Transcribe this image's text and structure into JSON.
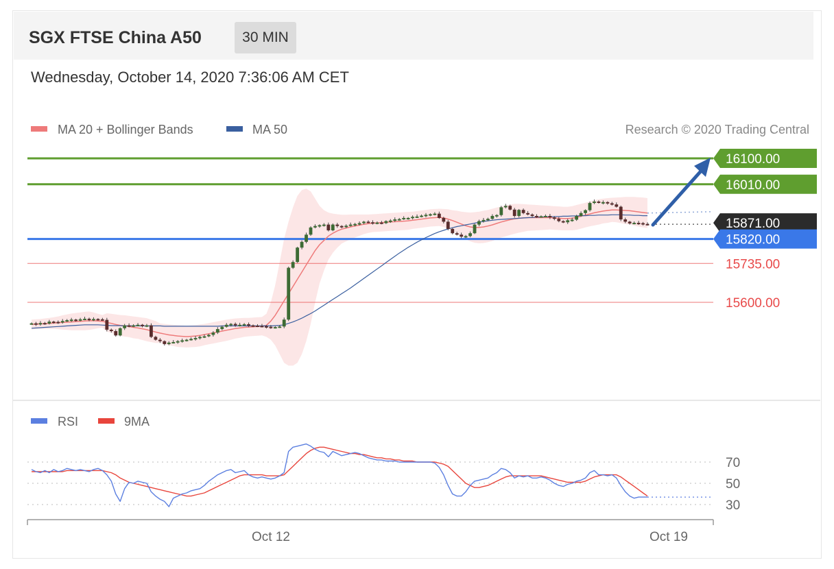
{
  "header": {
    "title": "SGX FTSE China A50",
    "timeframe": "30 MIN",
    "date": "Wednesday, October 14, 2020 7:36:06 AM CET"
  },
  "colors": {
    "ma20": "#ee7a7a",
    "band": "#fbe2e2",
    "ma50": "#3a5f9f",
    "resistance": "#5f9e2f",
    "support_blue": "#3a78e8",
    "support_red": "#e84a4a",
    "last": "#2b2b2b",
    "rsi": "#5b7fe0",
    "rsi_ma": "#e8453c",
    "arrow": "#2f5fa8"
  },
  "chart_data": [
    {
      "type": "candlestick",
      "legend": [
        {
          "name": "MA 20 + Bollinger Bands",
          "color": "#ee7a7a"
        },
        {
          "name": "MA 50",
          "color": "#3a5f9f"
        }
      ],
      "copyright": "Research © 2020 Trading Central",
      "ylim": [
        15490,
        16140
      ],
      "levels": [
        {
          "value": 16100,
          "label": "16100.00",
          "kind": "resistance"
        },
        {
          "value": 16010,
          "label": "16010.00",
          "kind": "resistance"
        },
        {
          "value": 15871,
          "label": "15871.00",
          "kind": "last"
        },
        {
          "value": 15820,
          "label": "15820.00",
          "kind": "pivot"
        },
        {
          "value": 15735,
          "label": "15735.00",
          "kind": "support"
        },
        {
          "value": 15600,
          "label": "15600.00",
          "kind": "support"
        }
      ],
      "close": [
        15527,
        15524,
        15528,
        15526,
        15533,
        15532,
        15530,
        15535,
        15538,
        15540,
        15538,
        15541,
        15543,
        15540,
        15542,
        15541,
        15539,
        15505,
        15500,
        15485,
        15510,
        15520,
        15518,
        15520,
        15522,
        15519,
        15520,
        15480,
        15470,
        15465,
        15455,
        15460,
        15462,
        15465,
        15468,
        15470,
        15473,
        15476,
        15480,
        15482,
        15487,
        15495,
        15507,
        15515,
        15522,
        15525,
        15520,
        15522,
        15524,
        15520,
        15519,
        15518,
        15517,
        15515,
        15513,
        15514,
        15516,
        15540,
        15720,
        15740,
        15790,
        15810,
        15835,
        15860,
        15865,
        15868,
        15870,
        15850,
        15870,
        15865,
        15862,
        15866,
        15870,
        15872,
        15875,
        15880,
        15878,
        15876,
        15877,
        15875,
        15882,
        15884,
        15888,
        15889,
        15893,
        15893,
        15897,
        15898,
        15901,
        15904,
        15906,
        15908,
        15893,
        15880,
        15855,
        15840,
        15835,
        15828,
        15830,
        15840,
        15870,
        15882,
        15886,
        15890,
        15900,
        15903,
        15930,
        15935,
        15922,
        15900,
        15921,
        15910,
        15905,
        15900,
        15898,
        15899,
        15900,
        15895,
        15890,
        15882,
        15878,
        15885,
        15887,
        15900,
        15910,
        15920,
        15945,
        15950,
        15946,
        15948,
        15944,
        15940,
        15932,
        15888,
        15880,
        15874,
        15876,
        15875,
        15872,
        15871
      ],
      "ma20": [
        15523,
        15524,
        15525,
        15526,
        15527,
        15528,
        15529,
        15530,
        15531,
        15532,
        15533,
        15534,
        15535,
        15536,
        15536,
        15535,
        15534,
        15530,
        15527,
        15523,
        15520,
        15518,
        15516,
        15513,
        15511,
        15508,
        15505,
        15501,
        15497,
        15493,
        15490,
        15487,
        15485,
        15483,
        15482,
        15481,
        15482,
        15483,
        15485,
        15488,
        15491,
        15494,
        15497,
        15500,
        15503,
        15506,
        15509,
        15511,
        15513,
        15514,
        15515,
        15516,
        15517,
        15520,
        15535,
        15555,
        15580,
        15605,
        15630,
        15655,
        15680,
        15705,
        15730,
        15755,
        15780,
        15800,
        15815,
        15830,
        15840,
        15848,
        15854,
        15858,
        15862,
        15865,
        15868,
        15871,
        15873,
        15875,
        15876,
        15877,
        15878,
        15879,
        15880,
        15881,
        15882,
        15883,
        15885,
        15887,
        15889,
        15891,
        15893,
        15894,
        15895,
        15893,
        15889,
        15884,
        15878,
        15872,
        15866,
        15862,
        15860,
        15860,
        15862,
        15865,
        15869,
        15874,
        15879,
        15883,
        15887,
        15890,
        15892,
        15893,
        15894,
        15894,
        15894,
        15894,
        15894,
        15894,
        15893,
        15892,
        15891,
        15891,
        15892,
        15895,
        15899,
        15903,
        15907,
        15911,
        15914,
        15917,
        15919,
        15921,
        15921,
        15920,
        15919,
        15918,
        15916,
        15914,
        15912,
        15910
      ],
      "upper": [
        15540,
        15541,
        15542,
        15544,
        15546,
        15548,
        15551,
        15555,
        15558,
        15561,
        15563,
        15565,
        15567,
        15568,
        15565,
        15560,
        15556,
        15562,
        15560,
        15558,
        15556,
        15555,
        15553,
        15551,
        15549,
        15547,
        15545,
        15540,
        15535,
        15527,
        15525,
        15523,
        15522,
        15521,
        15520,
        15519,
        15520,
        15521,
        15523,
        15525,
        15528,
        15531,
        15534,
        15537,
        15540,
        15542,
        15544,
        15545,
        15546,
        15546,
        15547,
        15548,
        15549,
        15560,
        15600,
        15660,
        15740,
        15820,
        15880,
        15930,
        15970,
        15990,
        15995,
        15985,
        15960,
        15935,
        15920,
        15912,
        15908,
        15906,
        15904,
        15904,
        15905,
        15905,
        15905,
        15905,
        15905,
        15906,
        15907,
        15908,
        15909,
        15910,
        15911,
        15912,
        15913,
        15914,
        15915,
        15917,
        15919,
        15921,
        15923,
        15924,
        15925,
        15924,
        15923,
        15920,
        15918,
        15915,
        15913,
        15912,
        15913,
        15915,
        15918,
        15921,
        15925,
        15929,
        15933,
        15937,
        15940,
        15942,
        15942,
        15941,
        15940,
        15939,
        15938,
        15937,
        15936,
        15935,
        15934,
        15933,
        15932,
        15932,
        15934,
        15938,
        15942,
        15946,
        15950,
        15955,
        15958,
        15960,
        15962,
        15963,
        15964,
        15965,
        15966,
        15966,
        15966,
        15965,
        15964,
        15962
      ],
      "lower": [
        15506,
        15507,
        15508,
        15508,
        15508,
        15508,
        15507,
        15505,
        15504,
        15503,
        15503,
        15503,
        15503,
        15504,
        15507,
        15510,
        15512,
        15498,
        15494,
        15488,
        15484,
        15481,
        15479,
        15475,
        15473,
        15469,
        15465,
        15462,
        15459,
        15459,
        15455,
        15451,
        15448,
        15445,
        15444,
        15443,
        15444,
        15445,
        15447,
        15451,
        15454,
        15457,
        15460,
        15463,
        15466,
        15470,
        15474,
        15477,
        15480,
        15482,
        15483,
        15484,
        15485,
        15480,
        15470,
        15450,
        15420,
        15390,
        15380,
        15380,
        15390,
        15420,
        15465,
        15525,
        15600,
        15665,
        15710,
        15748,
        15772,
        15790,
        15804,
        15812,
        15819,
        15825,
        15831,
        15837,
        15841,
        15844,
        15845,
        15846,
        15847,
        15848,
        15849,
        15850,
        15851,
        15852,
        15855,
        15857,
        15859,
        15861,
        15863,
        15864,
        15865,
        15862,
        15855,
        15848,
        15838,
        15829,
        15819,
        15812,
        15807,
        15805,
        15806,
        15809,
        15813,
        15819,
        15825,
        15829,
        15834,
        15838,
        15842,
        15845,
        15848,
        15849,
        15850,
        15851,
        15852,
        15853,
        15852,
        15851,
        15850,
        15850,
        15850,
        15852,
        15856,
        15860,
        15864,
        15867,
        15870,
        15874,
        15876,
        15879,
        15878,
        15875,
        15872,
        15870,
        15866,
        15863,
        15860,
        15858
      ],
      "ma50": [
        15510,
        15511,
        15512,
        15513,
        15514,
        15515,
        15516,
        15517,
        15518,
        15519,
        15520,
        15521,
        15522,
        15522,
        15522,
        15522,
        15521,
        15520,
        15519,
        15519,
        15519,
        15518,
        15518,
        15518,
        15518,
        15518,
        15518,
        15518,
        15518,
        15518,
        15517,
        15517,
        15517,
        15517,
        15517,
        15517,
        15517,
        15517,
        15517,
        15517,
        15517,
        15517,
        15517,
        15518,
        15518,
        15518,
        15518,
        15518,
        15518,
        15518,
        15518,
        15518,
        15518,
        15518,
        15518,
        15519,
        15520,
        15522,
        15527,
        15532,
        15538,
        15545,
        15553,
        15561,
        15570,
        15580,
        15590,
        15600,
        15610,
        15620,
        15630,
        15640,
        15650,
        15661,
        15672,
        15683,
        15694,
        15705,
        15716,
        15727,
        15738,
        15749,
        15760,
        15771,
        15781,
        15791,
        15800,
        15809,
        15817,
        15825,
        15832,
        15839,
        15845,
        15850,
        15855,
        15859,
        15863,
        15866,
        15869,
        15872,
        15875,
        15878,
        15881,
        15883,
        15885,
        15887,
        15888,
        15889,
        15890,
        15891,
        15892,
        15893,
        15894,
        15895,
        15896,
        15896,
        15897,
        15897,
        15898,
        15898,
        15899,
        15899,
        15900,
        15900,
        15901,
        15901,
        15902,
        15902,
        15903,
        15903,
        15903,
        15904,
        15904,
        15904,
        15903,
        15903,
        15902,
        15902,
        15901,
        15901
      ]
    },
    {
      "type": "line",
      "legend": [
        {
          "name": "RSI",
          "color": "#5b7fe0"
        },
        {
          "name": "9MA",
          "color": "#e8453c"
        }
      ],
      "ylim": [
        25,
        90
      ],
      "yticks": [
        70,
        50,
        30
      ],
      "xticks": [
        "Oct 12",
        "Oct 19"
      ],
      "rsi": [
        63,
        61,
        60,
        62,
        60,
        63,
        61,
        62,
        64,
        63,
        62,
        63,
        62,
        61,
        63,
        64,
        62,
        58,
        52,
        40,
        33,
        45,
        51,
        50,
        52,
        51,
        50,
        42,
        38,
        35,
        33,
        28,
        36,
        38,
        40,
        41,
        43,
        44,
        45,
        48,
        52,
        55,
        58,
        60,
        62,
        63,
        60,
        61,
        62,
        58,
        56,
        55,
        56,
        55,
        54,
        55,
        57,
        60,
        80,
        84,
        85,
        86,
        87,
        85,
        82,
        80,
        79,
        75,
        80,
        78,
        76,
        77,
        78,
        79,
        78,
        76,
        74,
        73,
        72,
        72,
        71,
        71,
        71,
        70,
        70,
        70,
        70,
        70,
        70,
        70,
        70,
        69,
        65,
        58,
        48,
        40,
        38,
        38,
        42,
        48,
        52,
        53,
        54,
        55,
        58,
        60,
        64,
        63,
        60,
        55,
        57,
        56,
        57,
        55,
        55,
        56,
        55,
        53,
        50,
        48,
        47,
        49,
        50,
        52,
        53,
        55,
        60,
        62,
        58,
        58,
        57,
        58,
        55,
        48,
        42,
        38,
        36,
        37,
        37,
        37
      ],
      "ma": [
        61,
        61,
        61,
        61,
        61,
        61,
        61,
        61,
        62,
        62,
        62,
        62,
        62,
        62,
        62,
        62,
        62,
        61,
        60,
        58,
        55,
        53,
        51,
        50,
        49,
        48,
        47,
        46,
        45,
        44,
        43,
        42,
        41,
        40,
        39,
        38,
        38,
        39,
        40,
        41,
        43,
        45,
        47,
        49,
        51,
        53,
        55,
        57,
        58,
        58,
        58,
        58,
        58,
        57,
        57,
        57,
        57,
        58,
        62,
        66,
        70,
        74,
        78,
        81,
        83,
        84,
        84,
        83,
        82,
        81,
        80,
        79,
        78,
        78,
        77,
        77,
        76,
        75,
        74,
        74,
        73,
        73,
        72,
        72,
        71,
        71,
        71,
        70,
        70,
        70,
        70,
        70,
        69,
        68,
        66,
        62,
        58,
        54,
        50,
        48,
        46,
        46,
        47,
        48,
        50,
        52,
        54,
        56,
        57,
        57,
        57,
        57,
        57,
        57,
        57,
        57,
        56,
        55,
        54,
        53,
        52,
        51,
        51,
        51,
        51,
        52,
        54,
        56,
        57,
        58,
        58,
        58,
        58,
        56,
        53,
        50,
        47,
        44,
        41,
        38
      ]
    }
  ]
}
